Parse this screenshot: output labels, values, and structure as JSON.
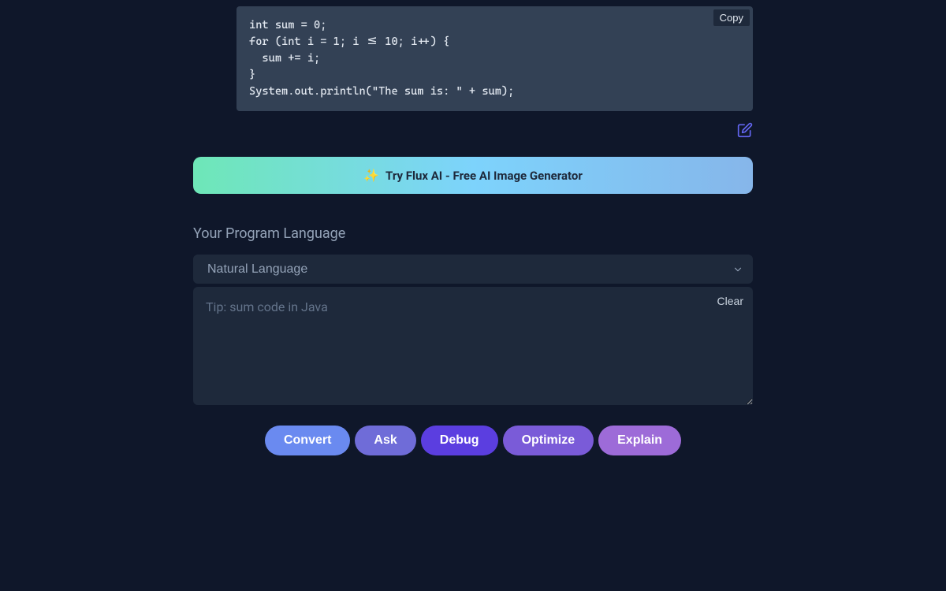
{
  "code_block": {
    "content": "int sum = 0;\nfor (int i = 1; i <= 10; i++) {\n  sum += i;\n}\nSystem.out.println(\"The sum is: \" + sum);",
    "copy_label": "Copy"
  },
  "promo": {
    "sparkle": "✨",
    "text": "Try Flux AI - Free AI Image Generator"
  },
  "language_section": {
    "label": "Your Program Language",
    "selected": "Natural Language"
  },
  "textarea": {
    "placeholder": "Tip: sum code in Java",
    "clear_label": "Clear"
  },
  "actions": {
    "convert": "Convert",
    "ask": "Ask",
    "debug": "Debug",
    "optimize": "Optimize",
    "explain": "Explain"
  }
}
